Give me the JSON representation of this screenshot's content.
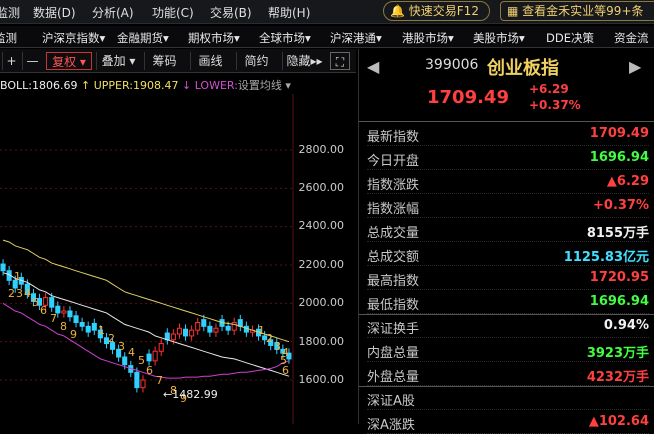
{
  "menu": [
    "监测",
    "数据(D)",
    "分析(A)",
    "功能(C)",
    "交易(B)",
    "帮助(H)"
  ],
  "quick_trade": "快速交易F12",
  "promo": "查看金禾实业等99+条",
  "nav": [
    "监测",
    "沪深京指数",
    "金融期货",
    "期权市场",
    "全球市场",
    "沪深港通",
    "港股市场",
    "美股市场",
    "DDE决策",
    "资金流"
  ],
  "toolbar": {
    "plus": "+",
    "minus": "—",
    "fuquan": "复权",
    "diejia": "叠加",
    "chouma": "筹码",
    "huaxian": "画线",
    "jianyue": "简约",
    "yincang": "隐藏"
  },
  "indicator": {
    "boll": "BOLL:1806.69",
    "upper": "UPPER:1908.47",
    "lower": "LOWER:",
    "setting": "设置均线"
  },
  "chart_data": {
    "type": "candlestick",
    "y_ticks": [
      "2800.00",
      "2600.00",
      "2400.00",
      "2200.00",
      "2000.00",
      "1800.00",
      "1600.00"
    ],
    "low_marker": "1482.99",
    "digits": [
      "1",
      "2",
      "3",
      "4",
      "5",
      "6",
      "7",
      "8",
      "9",
      "1",
      "2",
      "3",
      "4",
      "5",
      "6",
      "7",
      "8",
      "9",
      "1",
      "2",
      "3",
      "4",
      "5",
      "6"
    ],
    "colors": {
      "up": "#ff3030",
      "down": "#30d0ff",
      "upper": "#e0d060",
      "mid": "#e8e8e8",
      "lower": "#d040d0"
    }
  },
  "right": {
    "code": "399006",
    "name": "创业板指",
    "price": "1709.49",
    "change": "+6.29",
    "change_pct": "+0.37%",
    "rows": [
      {
        "label": "最新指数",
        "value": "1709.49",
        "color": "red"
      },
      {
        "label": "今日开盘",
        "value": "1696.94",
        "color": "green"
      },
      {
        "label": "指数涨跌",
        "value": "▲6.29",
        "color": "red"
      },
      {
        "label": "指数涨幅",
        "value": "+0.37%",
        "color": "red"
      },
      {
        "label": "总成交量",
        "value": "8155万手",
        "color": "white"
      },
      {
        "label": "总成交额",
        "value": "1125.83亿元",
        "color": "cyan"
      },
      {
        "label": "最高指数",
        "value": "1720.95",
        "color": "red"
      },
      {
        "label": "最低指数",
        "value": "1696.94",
        "color": "green"
      },
      {
        "label": "深证换手",
        "value": "0.94%",
        "color": "white"
      },
      {
        "label": "内盘总量",
        "value": "3923万手",
        "color": "green"
      },
      {
        "label": "外盘总量",
        "value": "4232万手",
        "color": "red"
      },
      {
        "label": "深证A股",
        "value": "",
        "color": "white"
      },
      {
        "label": "深A涨跌",
        "value": "▲102.64",
        "color": "red"
      }
    ]
  }
}
